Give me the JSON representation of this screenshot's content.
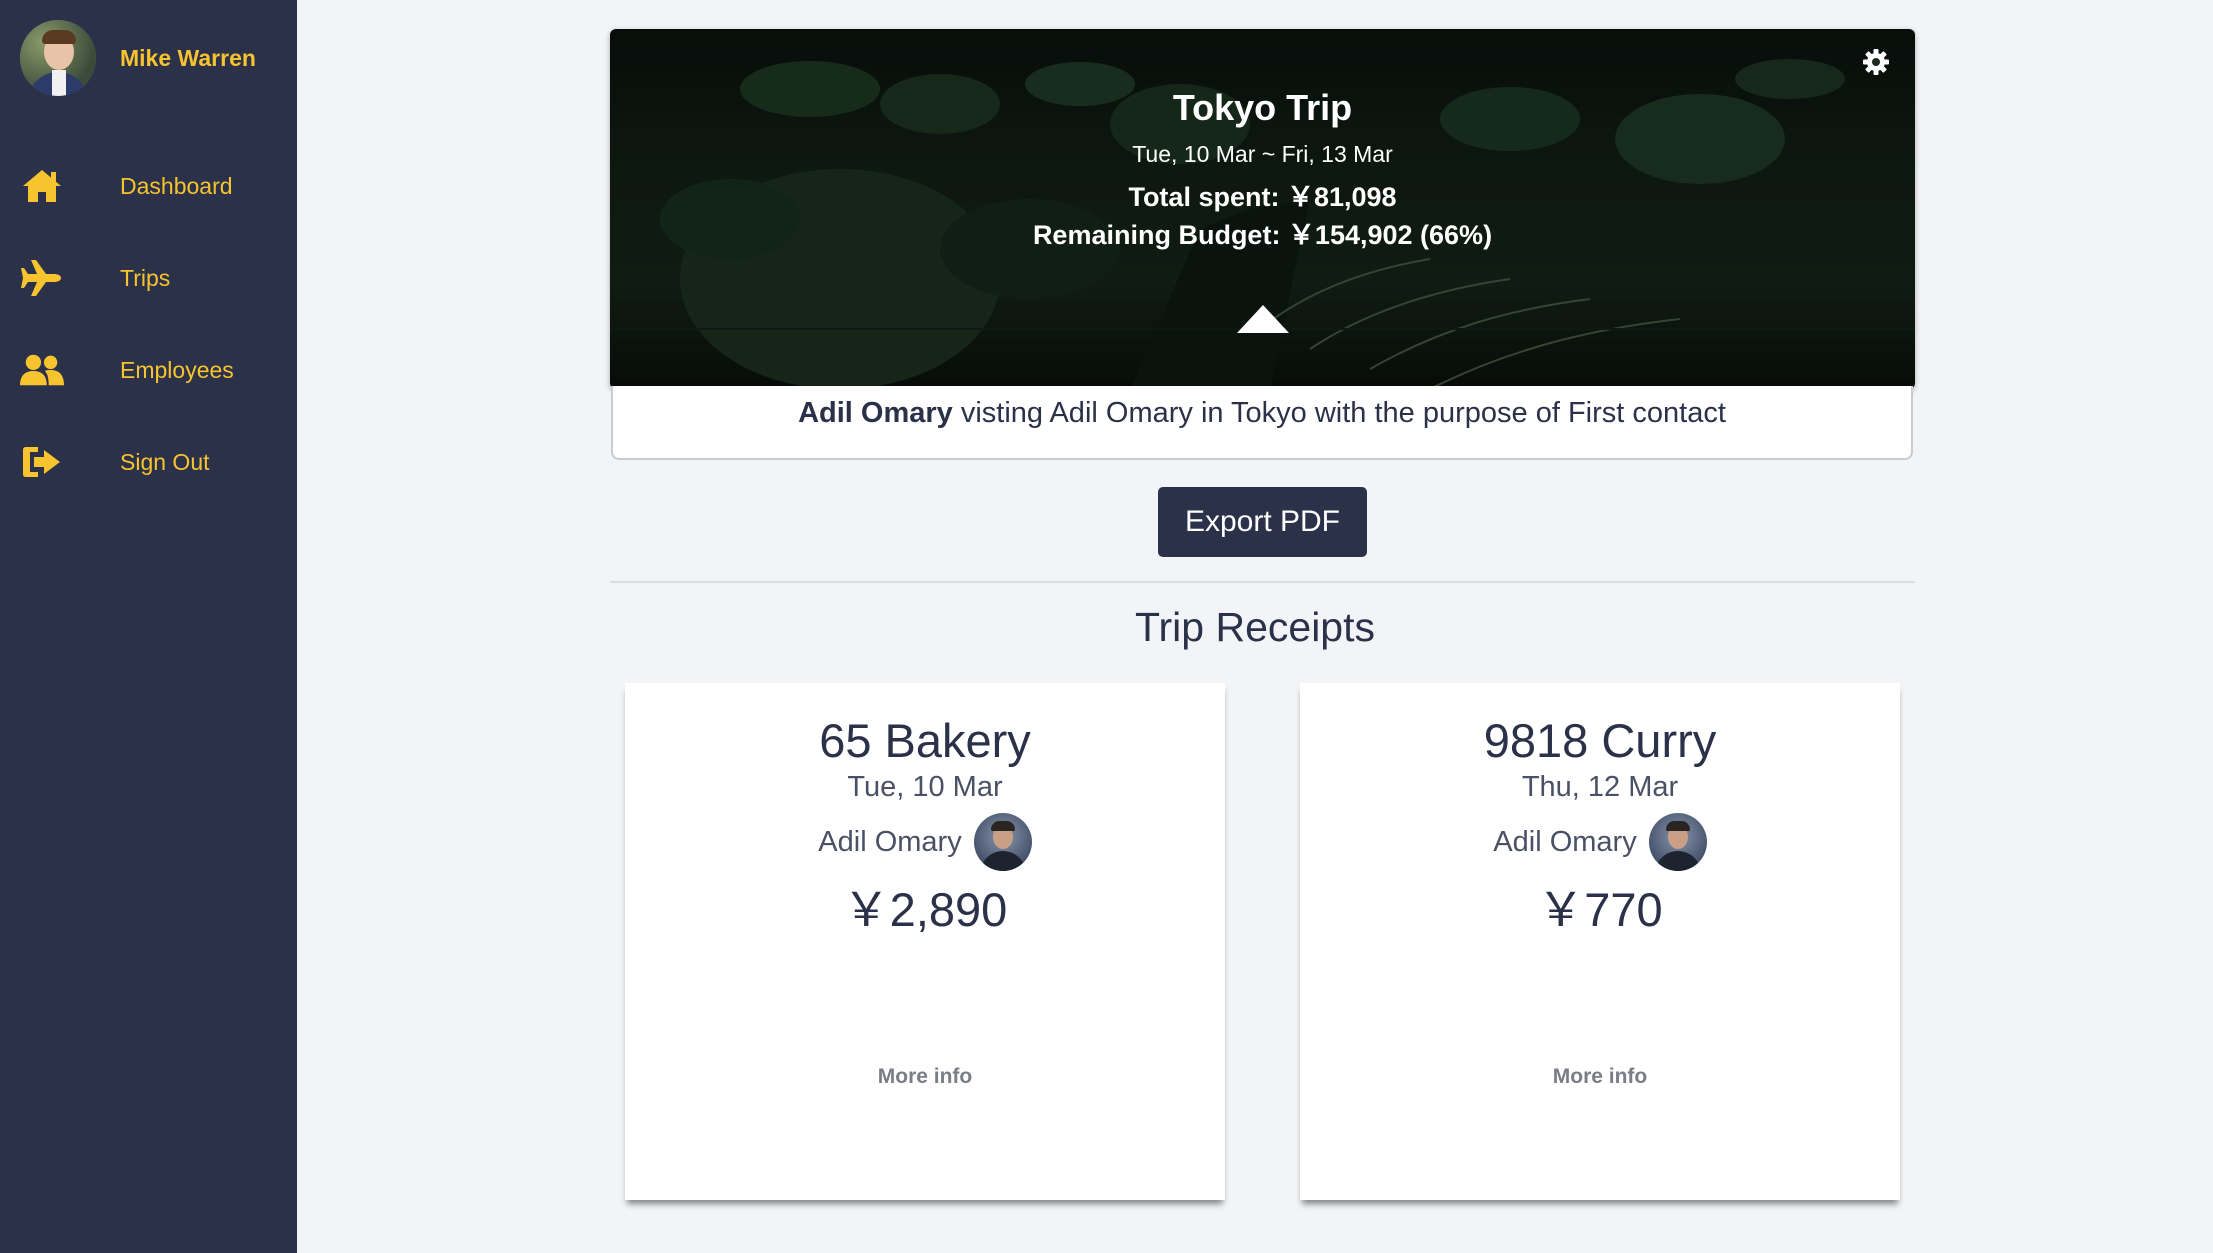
{
  "sidebar": {
    "user_name": "Mike Warren",
    "items": [
      {
        "label": "Dashboard",
        "icon": "home-icon"
      },
      {
        "label": "Trips",
        "icon": "plane-icon"
      },
      {
        "label": "Employees",
        "icon": "users-icon"
      },
      {
        "label": "Sign Out",
        "icon": "sign-out-icon"
      }
    ]
  },
  "trip": {
    "title": "Tokyo Trip",
    "dates": "Tue, 10 Mar ~ Fri, 13 Mar",
    "total_spent": "Total spent:  ￥81,098",
    "remaining_budget": "Remaining Budget:  ￥154,902 (66%)",
    "purpose_name": "Adil Omary",
    "purpose_text": "visting Adil Omary in Tokyo with the purpose of First contact"
  },
  "actions": {
    "export_label": "Export PDF"
  },
  "receipts_section": {
    "title": "Trip Receipts",
    "receipts": [
      {
        "name": "65 Bakery",
        "date": "Tue, 10 Mar",
        "employee": "Adil Omary",
        "amount": "￥2,890",
        "more": "More info"
      },
      {
        "name": "9818 Curry",
        "date": "Thu, 12 Mar",
        "employee": "Adil Omary",
        "amount": "￥770",
        "more": "More info"
      }
    ]
  },
  "colors": {
    "sidebar_bg": "#2a3148",
    "accent": "#f7c32e",
    "button_bg": "#2a3148",
    "page_bg": "#f2f4f7"
  }
}
